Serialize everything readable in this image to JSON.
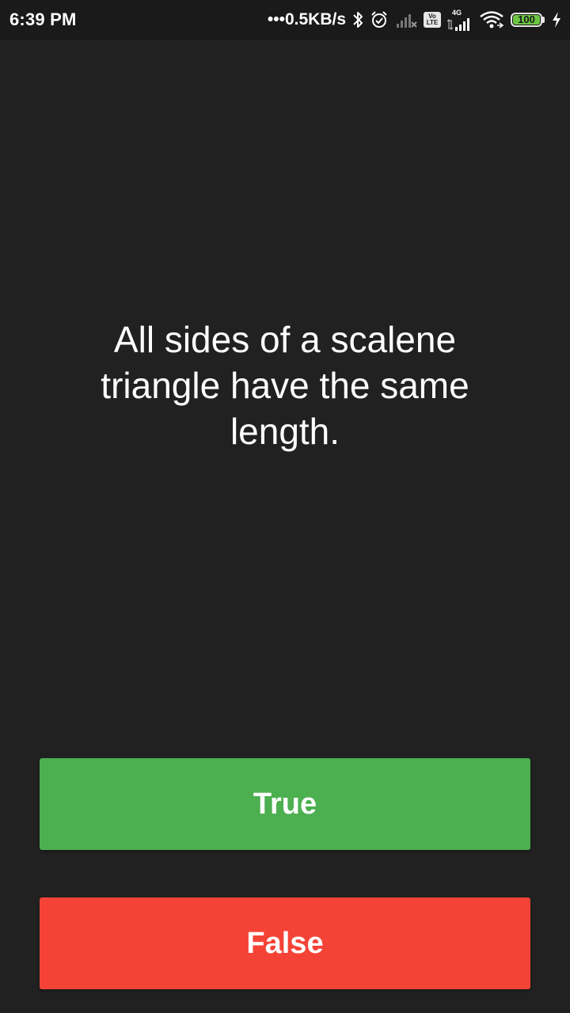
{
  "status_bar": {
    "time": "6:39 PM",
    "net_speed": "•••0.5KB/s",
    "icons": [
      "bluetooth-icon",
      "alarm-icon",
      "signal-sim1-icon",
      "volte-icon",
      "signal-4g-icon",
      "wifi-icon",
      "battery-icon",
      "charging-icon"
    ],
    "volte_top": "Vo",
    "volte_bottom": "LTE",
    "network_type": "4G",
    "battery_level": "100",
    "battery_color": "#6cc644"
  },
  "quiz": {
    "question": "All sides of a scalene triangle have the same length.",
    "true_label": "True",
    "false_label": "False",
    "true_color": "#4caf50",
    "false_color": "#f44336",
    "background": "#212121"
  }
}
